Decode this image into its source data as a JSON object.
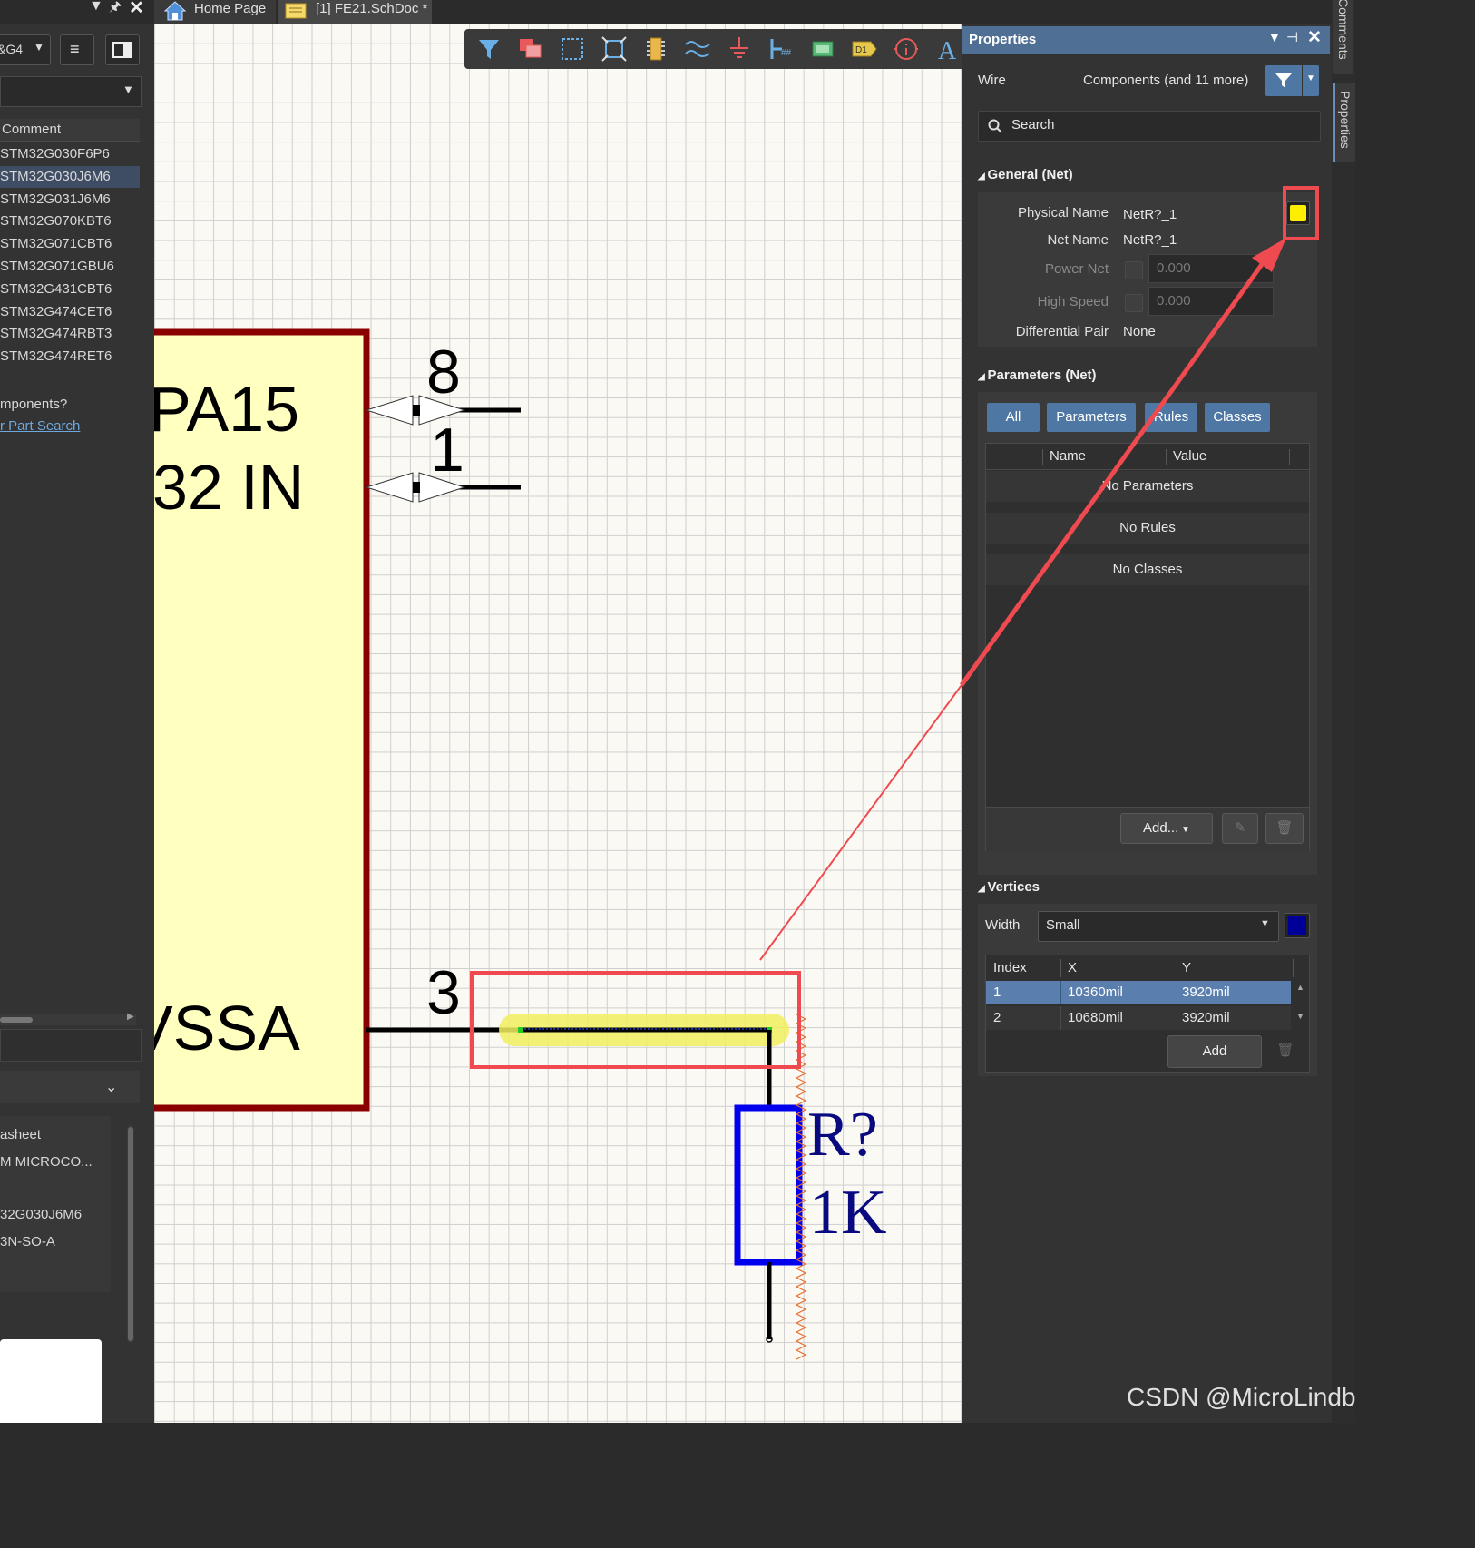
{
  "tabs": {
    "home": "Home Page",
    "doc": "[1] FE21.SchDoc *"
  },
  "left_panel": {
    "top_dropdown": "&G4",
    "column_header": "Comment",
    "components": [
      "STM32G030F6P6",
      "STM32G030J6M6",
      "STM32G031J6M6",
      "STM32G070KBT6",
      "STM32G071CBT6",
      "STM32G071GBU6",
      "STM32G431CBT6",
      "STM32G474CET6",
      "STM32G474RBT3",
      "STM32G474RET6"
    ],
    "selected_index": 1,
    "question": "mponents?",
    "part_search_link": "r Part Search",
    "details": [
      "asheet",
      "M MICROCO...",
      "32G030J6M6",
      "3N-SO-A"
    ]
  },
  "schematic": {
    "pin_numbers": [
      "8",
      "1",
      "3"
    ],
    "component_labels": [
      "PA15",
      "32 IN",
      "VSSA"
    ],
    "resistor_designator": "R?",
    "resistor_value": "1K",
    "watermark": "CSDN @MicroLindb"
  },
  "properties": {
    "title": "Properties",
    "object_type": "Wire",
    "filter_text": "Components (and 11 more)",
    "search_placeholder": "Search",
    "general": {
      "title": "General (Net)",
      "physical_name_label": "Physical Name",
      "physical_name": "NetR?_1",
      "net_name_label": "Net Name",
      "net_name": "NetR?_1",
      "power_net_label": "Power Net",
      "power_net_value": "0.000",
      "high_speed_label": "High Speed",
      "high_speed_value": "0.000",
      "diff_pair_label": "Differential Pair",
      "diff_pair": "None",
      "net_color": "#ffee00"
    },
    "parameters": {
      "title": "Parameters (Net)",
      "filters": [
        "All",
        "Parameters",
        "Rules",
        "Classes"
      ],
      "col_name": "Name",
      "col_value": "Value",
      "rows": [
        "No Parameters",
        "No Rules",
        "No Classes"
      ],
      "add_button": "Add..."
    },
    "vertices": {
      "title": "Vertices",
      "width_label": "Width",
      "width_value": "Small",
      "wire_color": "#000099",
      "col_index": "Index",
      "col_x": "X",
      "col_y": "Y",
      "rows": [
        {
          "index": "1",
          "x": "10360mil",
          "y": "3920mil"
        },
        {
          "index": "2",
          "x": "10680mil",
          "y": "3920mil"
        }
      ],
      "add_button": "Add"
    }
  },
  "side_tabs": [
    "Comments",
    "Properties"
  ],
  "annotation_color": "#ef4a4f"
}
